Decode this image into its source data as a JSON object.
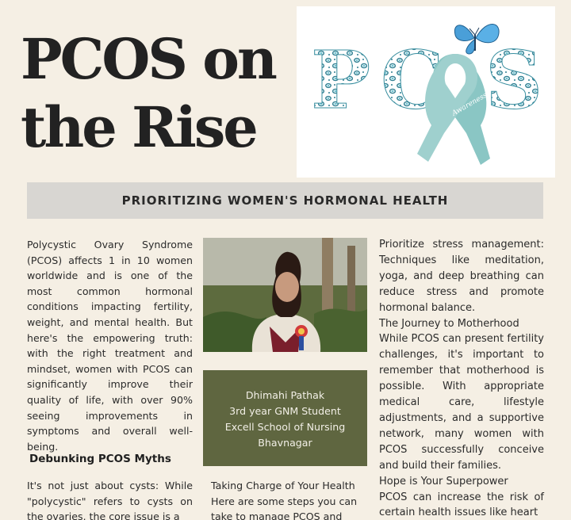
{
  "title": {
    "line1": "PCOS on",
    "line2": "the Rise"
  },
  "logo": {
    "letters": [
      "P",
      "C",
      "S"
    ],
    "ribbon_color": "#8ac6c4",
    "butterfly_color": "#4a9fd8",
    "pattern_color": "#5fb6c2",
    "ribbon_script": "Awareness"
  },
  "banner": {
    "text": "PRIORITIZING WOMEN'S HORMONAL HEALTH"
  },
  "intro": {
    "text": "Polycystic Ovary Syndrome (PCOS) affects 1 in 10 women worldwide and is one of the most common hormonal conditions impacting fertility, weight, and mental health. But here's the empowering truth: with the right treatment and mindset, women with PCOS can significantly improve their quality of life, with over 90% seeing improvements in symptoms and overall well-being."
  },
  "author": {
    "name": "Dhimahi Pathak",
    "role": "3rd year GNM Student",
    "school": "Excell School of Nursing",
    "city": "Bhavnagar"
  },
  "myths": {
    "heading": "Debunking PCOS Myths",
    "text": "It's not just about cysts: While \"polycystic\" refers to cysts on the ovaries, the core issue is a"
  },
  "taking_charge": {
    "text": "Taking Charge of Your Health Here are some steps you can take to manage PCOS and"
  },
  "col3": {
    "stress": "Prioritize stress management: Techniques like meditation, yoga, and deep breathing can reduce stress and promote hormonal balance.",
    "motherhood_heading": "The Journey to Motherhood",
    "motherhood": "While PCOS can present fertility challenges, it's important to remember that motherhood is possible. With appropriate medical care, lifestyle adjustments, and a supportive network, many women with PCOS successfully conceive and build their families.",
    "hope_heading": "Hope is Your Superpower",
    "hope": "PCOS can increase the risk of certain health issues like heart"
  },
  "colors": {
    "page_bg": "#f5efe4",
    "banner_bg": "#d8d6d2",
    "author_bg": "#5f6640",
    "title_color": "#222222"
  }
}
